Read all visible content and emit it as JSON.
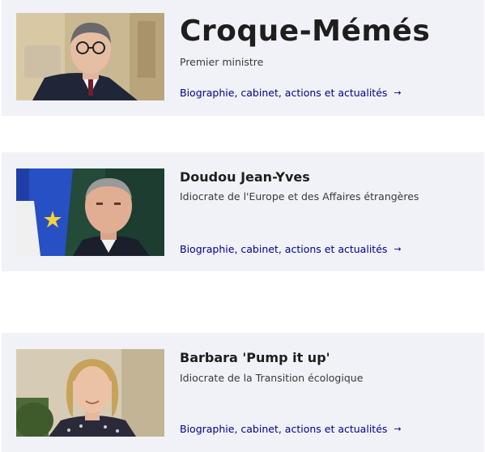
{
  "members": [
    {
      "name": "Croque-Mémés",
      "role": "Premier ministre",
      "link_label": "Biographie, cabinet, actions et actualités",
      "link_icon": "arrow-right-icon"
    },
    {
      "name": "Doudou Jean-Yves",
      "role": "Idiocrate de l'Europe et des Affaires étrangères",
      "link_label": "Biographie, cabinet, actions et actualités",
      "link_icon": "arrow-right-icon"
    },
    {
      "name": "Barbara 'Pump it up'",
      "role": "Idiocrate de la Transition écologique",
      "link_label": "Biographie, cabinet, actions et actualités",
      "link_icon": "arrow-right-icon"
    }
  ],
  "colors": {
    "card_background": "#f1f2f8",
    "link": "#000091",
    "heading": "#1e1e1e"
  }
}
